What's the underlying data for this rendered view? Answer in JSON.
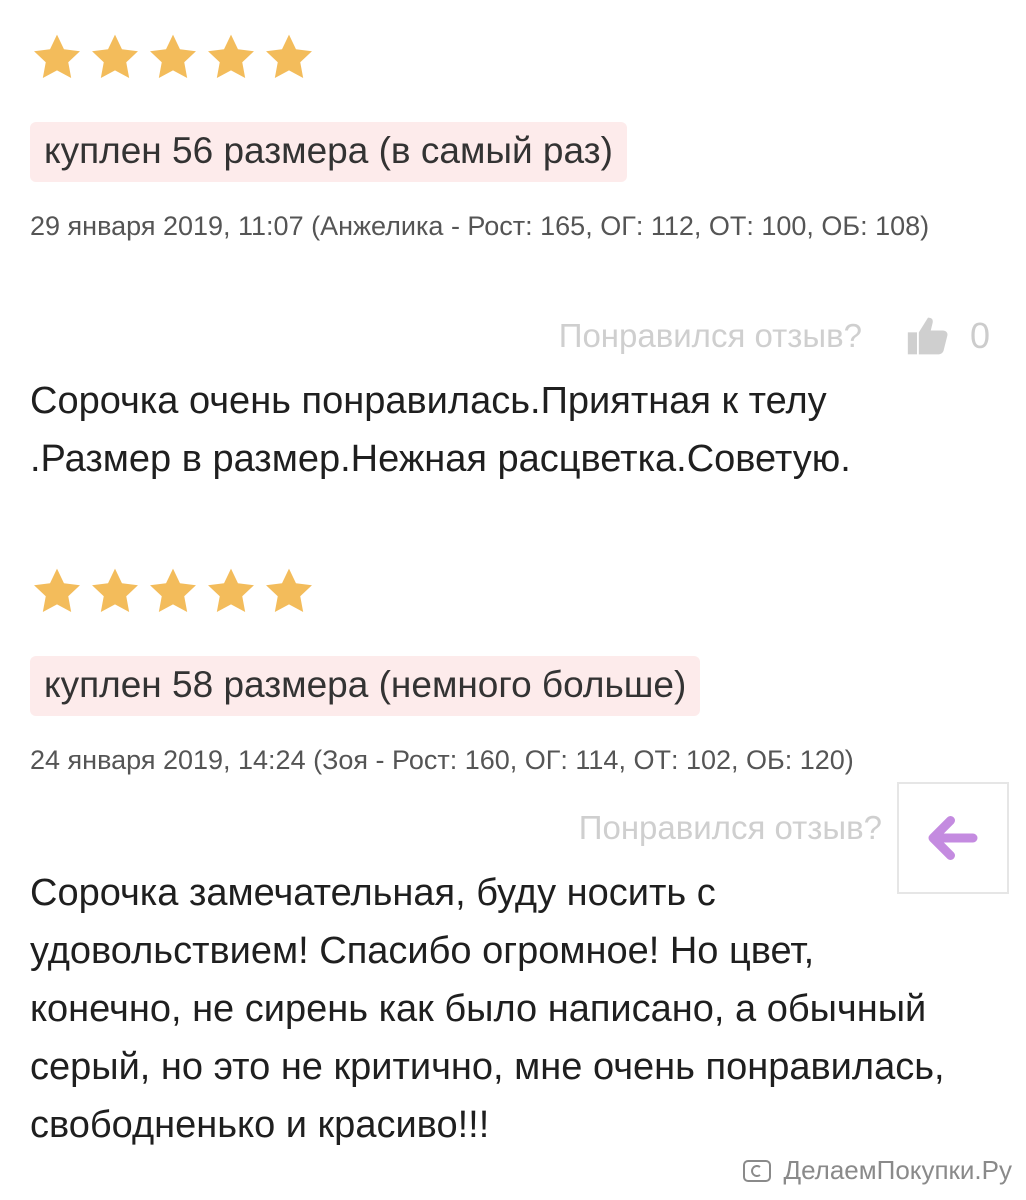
{
  "reviews": [
    {
      "rating": 5,
      "size_badge": "куплен 56 размера (в самый раз)",
      "meta": "29 января 2019, 11:07 (Анжелика - Рост: 165, ОГ: 112, ОТ: 100, ОБ: 108)",
      "like_prompt": "Понравился отзыв?",
      "like_count": "0",
      "text": "Сорочка очень понравилась.Приятная к телу .Размер в размер.Нежная расцветка.Советую."
    },
    {
      "rating": 5,
      "size_badge": "куплен 58 размера (немного больше)",
      "meta": "24 января 2019, 14:24 (Зоя - Рост: 160, ОГ: 114, ОТ: 102, ОБ: 120)",
      "like_prompt": "Понравился отзыв?",
      "like_count": "",
      "text": "Сорочка замечательная, буду носить с удовольствием! Спасибо огромное! Но цвет, конечно, не сирень как было написано, а обычный серый, но это не критично, мне очень понравилась, свободненько и красиво!!!"
    }
  ],
  "colors": {
    "star": "#f3bc5b",
    "badge_bg": "#fdebeb",
    "back_arrow": "#c48be0"
  },
  "icons": {
    "star": "star-icon",
    "like": "thumbs-up-icon",
    "back": "arrow-left-icon",
    "watermark_logo": "watermark-logo-icon"
  },
  "watermark": {
    "text": "ДелаемПокупки.Ру"
  }
}
